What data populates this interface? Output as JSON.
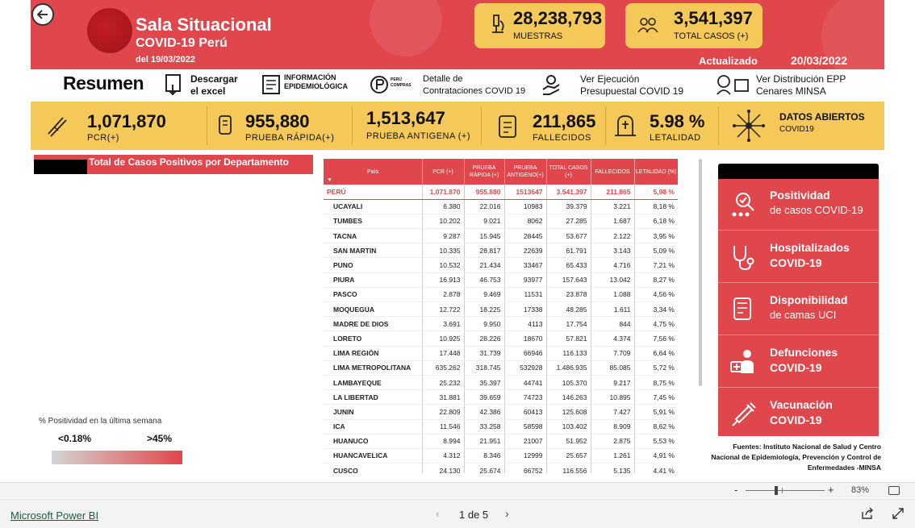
{
  "header": {
    "title": "Sala Situacional",
    "subtitle": "COVID-19 Perú",
    "date": "del 19/03/2022",
    "updated_label": "Actualizado",
    "updated_date": "20/03/2022"
  },
  "kpi_top": [
    {
      "value": "28,238,793",
      "label": "MUESTRAS",
      "icon": "microscope-icon"
    },
    {
      "value": "3,541,397",
      "label": "TOTAL CASOS (+)",
      "icon": "people-icon"
    }
  ],
  "links": {
    "resumen": "Resumen",
    "excel_1": "Descargar",
    "excel_2": "el excel",
    "info_1": "INFORMACIÓN",
    "info_2": "EPIDEMIOLÓGICA",
    "peru_compras": "PERÚ COMPRAS",
    "contratos_1": "Detalle de",
    "contratos_2": "Contrataciones COVID 19",
    "ejecucion_1": "Ver Ejecución",
    "ejecucion_2": "Presupuestal COVID 19",
    "epp_1": "Ver Distribución EPP",
    "epp_2": "Cenares MINSA"
  },
  "band": [
    {
      "value": "1,071,870",
      "label": "PCR(+)"
    },
    {
      "value": "955,880",
      "label": "PRUEBA RÁPIDA(+)"
    },
    {
      "value": "1,513,647",
      "label": "PRUEBA ANTIGENA (+)"
    },
    {
      "value": "211,865",
      "label": "FALLECIDOS"
    },
    {
      "value": "5.98 %",
      "label": "LETALIDAD"
    },
    {
      "value": "DATOS ABIERTOS",
      "label": "COVID19"
    }
  ],
  "left_panel": {
    "title": "Total de Casos Positivos por Departamento",
    "legend_label": "% Positividad en la última semana",
    "legend_min": "<0.18%",
    "legend_max": ">45%"
  },
  "table": {
    "headers": [
      "País",
      "PCR (+)",
      "PRUEBA RÁPIDA (+)",
      "PRUEBA ANTIGENO(+)",
      "TOTAL CASOS (+)",
      "FALLECIDOS",
      "LETALIDAD (%)"
    ],
    "total": [
      "PERÚ",
      "1.071.870",
      "955.880",
      "1513647",
      "3.541.397",
      "211.865",
      "5,98 %"
    ],
    "rows": [
      [
        "UCAYALI",
        "6.380",
        "22.016",
        "10983",
        "39.379",
        "3.221",
        "8,18 %"
      ],
      [
        "TUMBES",
        "10.202",
        "9.021",
        "8062",
        "27.285",
        "1.687",
        "6,18 %"
      ],
      [
        "TACNA",
        "9.287",
        "15.945",
        "28445",
        "53.677",
        "2.122",
        "3,95 %"
      ],
      [
        "SAN MARTIN",
        "10.335",
        "28.817",
        "22639",
        "61.791",
        "3.143",
        "5,09 %"
      ],
      [
        "PUNO",
        "10.532",
        "21.434",
        "33467",
        "65.433",
        "4.716",
        "7,21 %"
      ],
      [
        "PIURA",
        "16.913",
        "46.753",
        "93977",
        "157.643",
        "13.042",
        "8,27 %"
      ],
      [
        "PASCO",
        "2.878",
        "9.469",
        "11531",
        "23.878",
        "1.088",
        "4,56 %"
      ],
      [
        "MOQUEGUA",
        "12.722",
        "18.225",
        "17338",
        "48.285",
        "1.611",
        "3,34 %"
      ],
      [
        "MADRE DE DIOS",
        "3.691",
        "9.950",
        "4113",
        "17.754",
        "844",
        "4,75 %"
      ],
      [
        "LORETO",
        "10.925",
        "28.226",
        "18670",
        "57.821",
        "4.374",
        "7,56 %"
      ],
      [
        "LIMA REGIÓN",
        "17.448",
        "31.739",
        "66946",
        "116.133",
        "7.709",
        "6,64 %"
      ],
      [
        "LIMA METROPOLITANA",
        "635.262",
        "318.745",
        "532928",
        "1.486.935",
        "85.085",
        "5,72 %"
      ],
      [
        "LAMBAYEQUE",
        "25.232",
        "35.397",
        "44741",
        "105.370",
        "9.217",
        "8,75 %"
      ],
      [
        "LA LIBERTAD",
        "31.881",
        "39.659",
        "74723",
        "146.263",
        "10.895",
        "7,45 %"
      ],
      [
        "JUNIN",
        "22.809",
        "42.386",
        "60413",
        "125.608",
        "7.427",
        "5,91 %"
      ],
      [
        "ICA",
        "11.546",
        "33.258",
        "58598",
        "103.402",
        "8.909",
        "8,62 %"
      ],
      [
        "HUANUCO",
        "8.994",
        "21.951",
        "21007",
        "51.952",
        "2.875",
        "5,53 %"
      ],
      [
        "HUANCAVELICA",
        "4.312",
        "8.346",
        "12999",
        "25.657",
        "1.261",
        "4,91 %"
      ],
      [
        "CUSCO",
        "24.130",
        "25.674",
        "66752",
        "116.556",
        "5.135",
        "4,41 %"
      ]
    ]
  },
  "right_panel": [
    {
      "t1": "Positividad",
      "t2": "de casos COVID-19",
      "icon": "positivity-icon"
    },
    {
      "t1": "Hospitalizados",
      "t2": "COVID-19",
      "icon": "stethoscope-icon"
    },
    {
      "t1": "Disponibilidad",
      "t2": "de camas UCI",
      "icon": "bed-icon"
    },
    {
      "t1": "Defunciones",
      "t2": "COVID-19",
      "icon": "deaths-icon"
    },
    {
      "t1": "Vacunación",
      "t2": "COVID-19",
      "icon": "syringe-icon"
    }
  ],
  "sources": {
    "line1": "Fuentes: Instituto Nacional de Salud y Centro",
    "line2": "Nacional de Epidemiología, Prevención y Control de",
    "line3": "Enfermedades -MINSA"
  },
  "zoom": {
    "minus": "-",
    "plus": "+",
    "percent": "83%"
  },
  "footer": {
    "brand": "Microsoft Power BI",
    "pager": "1 de 5",
    "prev": "‹",
    "next": "›"
  },
  "colors": {
    "accent": "#e0474c",
    "yellow": "#f5c85a"
  }
}
